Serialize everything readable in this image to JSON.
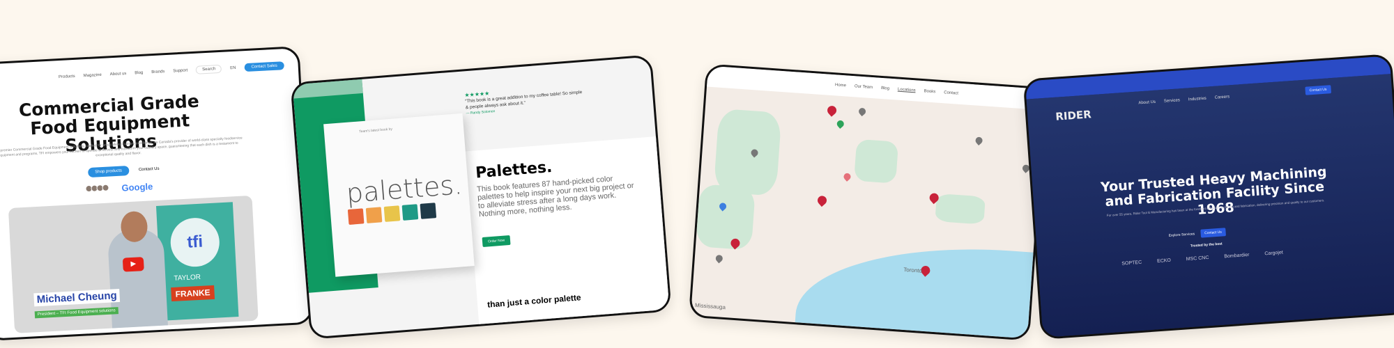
{
  "background": "#fdf7ee",
  "card_food": {
    "nav": [
      "Products",
      "Magazine",
      "About us",
      "Blog",
      "Brands",
      "Support"
    ],
    "search_placeholder": "Search",
    "lang": "EN",
    "cta": "Contact Sales",
    "title": "Commercial Grade Food Equipment Solutions",
    "subtitle": "Our premier Commercial Grade Food Equipment Solutions, crafted for unparalleled culinary excellence. As Canada's provider of world-class specialty foodservice equipment and programs, TFI empowers your kitchen to operate at its best and transform your culinary space, guaranteeing that each dish is a testament to exceptional quality and flavor.",
    "primary_btn": "Shop products",
    "secondary_btn": "Contact Us",
    "google": "Google",
    "video": {
      "person": "Michael Cheung",
      "role": "President – TFI Food Equipment solutions",
      "logo": "tfi",
      "brand1": "TAYLOR",
      "brand2": "FRANKE",
      "play_color": "#e62117"
    },
    "accent": "#2a8fe0"
  },
  "card_palettes": {
    "stars": "★★★★★",
    "review": "“This book is a great addition to my coffee table! So simple & people always ask about it.”",
    "reviewer": "— Randy Solomon",
    "cover_label": "Team's latest book by",
    "cover_title": "palettes.",
    "swatches": [
      "#e8663a",
      "#f0a04a",
      "#e8c44a",
      "#1f9a86",
      "#1f3a48"
    ],
    "title": "Palettes.",
    "body": "This book features 87 hand-picked color palettes to help inspire your next big project or to alleviate stress after a long days work. Nothing more, nothing less.",
    "order_btn": "Order Now",
    "more": "than just a color palette",
    "accent": "#0f9a62"
  },
  "card_map": {
    "nav": [
      "Home",
      "Our Team",
      "Blog",
      "Locations",
      "Books",
      "Contact"
    ],
    "active": "Locations",
    "labels": [
      "Toronto",
      "Mississauga"
    ]
  },
  "card_rider": {
    "logo": "RIDER",
    "nav": [
      "About Us",
      "Services",
      "Industries",
      "Careers"
    ],
    "contact_btn": "Contact Us",
    "title": "Your Trusted Heavy Machining and Fabrication Facility Since 1968",
    "subtitle": "For over 55 years, Rider Tool & Manufacturing has been at the forefront of heavy machining and fabrication, delivering precision and quality to our customers.",
    "explore_btn": "Explore Services",
    "contact2_btn": "Contact Us",
    "trusted": "Trusted by the best",
    "logos": [
      "SOPTEC",
      "ECKO",
      "MSC CNC",
      "Bombardier",
      "Cargojet"
    ],
    "accent": "#2a4bc5"
  }
}
